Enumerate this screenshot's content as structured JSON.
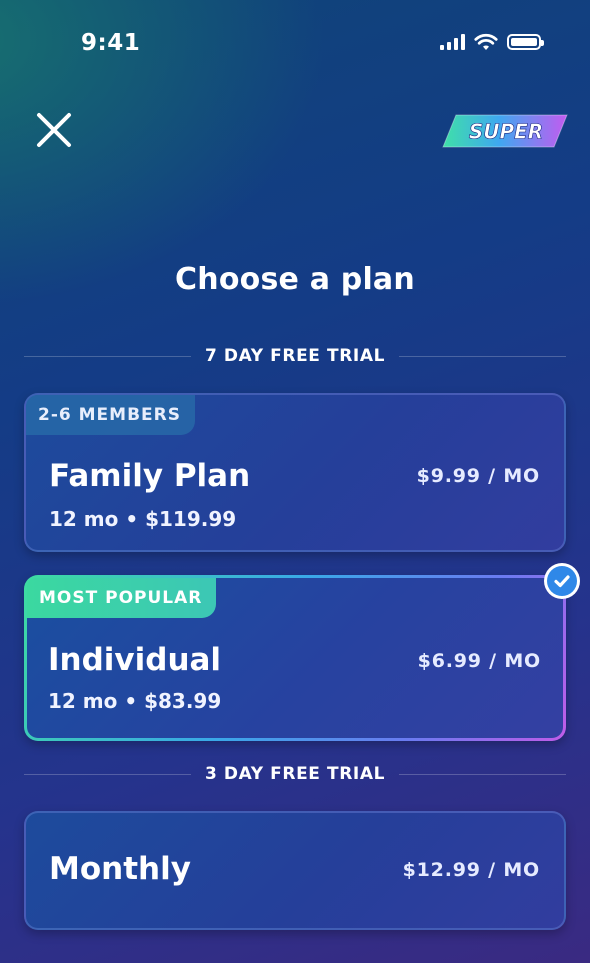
{
  "status_bar": {
    "time": "9:41",
    "signal_icon": "cellular-signal-icon",
    "wifi_icon": "wifi-icon",
    "battery_icon": "battery-icon"
  },
  "header": {
    "close_icon": "close-icon",
    "badge_text": "SUPER"
  },
  "title": "Choose a plan",
  "sections": [
    {
      "label": "7 DAY FREE TRIAL",
      "plans": [
        {
          "tag": "2-6 MEMBERS",
          "name": "Family Plan",
          "billing": "12 mo • $119.99",
          "price": "$9.99 / MO",
          "selected": false
        },
        {
          "tag": "MOST POPULAR",
          "name": "Individual",
          "billing": "12 mo • $83.99",
          "price": "$6.99 / MO",
          "selected": true
        }
      ]
    },
    {
      "label": "3 DAY FREE TRIAL",
      "plans": [
        {
          "tag": "",
          "name": "Monthly",
          "billing": "",
          "price": "$12.99 / MO",
          "selected": false
        }
      ]
    }
  ],
  "colors": {
    "accent_green": "#3bd8a0",
    "accent_blue": "#2f88e8",
    "accent_purple": "#c05ce8",
    "card_bg": "#253f9a"
  }
}
